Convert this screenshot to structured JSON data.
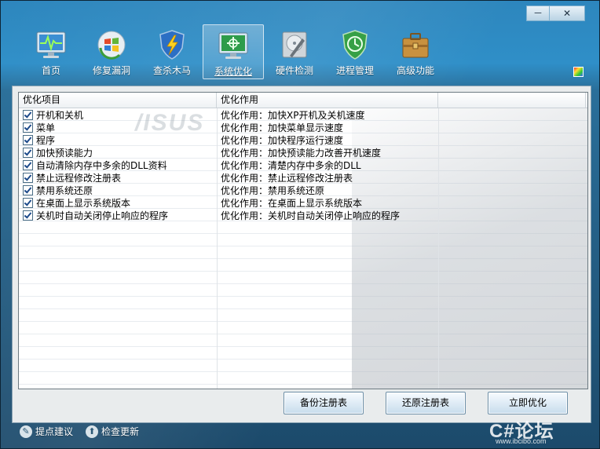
{
  "window": {
    "minimize_label": "－",
    "close_label": "✕"
  },
  "toolbar": {
    "items": [
      {
        "label": "首页",
        "icon": "monitor-pulse-icon"
      },
      {
        "label": "修复漏洞",
        "icon": "windows-refresh-icon"
      },
      {
        "label": "查杀木马",
        "icon": "shield-lightning-icon"
      },
      {
        "label": "系统优化",
        "icon": "monitor-optimize-icon",
        "active": true
      },
      {
        "label": "硬件检测",
        "icon": "hdd-wrench-icon"
      },
      {
        "label": "进程管理",
        "icon": "shield-clock-icon"
      },
      {
        "label": "高级功能",
        "icon": "toolbox-icon"
      }
    ]
  },
  "list": {
    "headers": [
      "优化项目",
      "优化作用"
    ],
    "rows": [
      {
        "item": "开机和关机",
        "effect": "优化作用：加快XP开机及关机速度",
        "checked": true
      },
      {
        "item": "菜单",
        "effect": "优化作用：加快菜单显示速度",
        "checked": true
      },
      {
        "item": "程序",
        "effect": "优化作用：加快程序运行速度",
        "checked": true
      },
      {
        "item": "加快预读能力",
        "effect": "优化作用：加快预读能力改善开机速度",
        "checked": true
      },
      {
        "item": "自动清除内存中多余的DLL资料",
        "effect": "优化作用：清楚内存中多余的DLL",
        "checked": true
      },
      {
        "item": "禁止远程修改注册表",
        "effect": "优化作用：禁止远程修改注册表",
        "checked": true
      },
      {
        "item": "禁用系统还原",
        "effect": "优化作用：禁用系统还原",
        "checked": true
      },
      {
        "item": "在桌面上显示系统版本",
        "effect": "优化作用：在桌面上显示系统版本",
        "checked": true
      },
      {
        "item": "关机时自动关闭停止响应的程序",
        "effect": "优化作用：关机时自动关闭停止响应的程序",
        "checked": true
      }
    ],
    "background_text": "/ISUS"
  },
  "buttons": {
    "backup": "备份注册表",
    "restore": "还原注册表",
    "optimize": "立即优化"
  },
  "footer": {
    "suggest": "提点建议",
    "update": "检查更新"
  },
  "watermark": {
    "logo": "C#论坛",
    "url": "www.ibcibo.com"
  },
  "colors": {
    "accent": "#2f8fc8",
    "frame_dark": "#1c4a6b"
  }
}
